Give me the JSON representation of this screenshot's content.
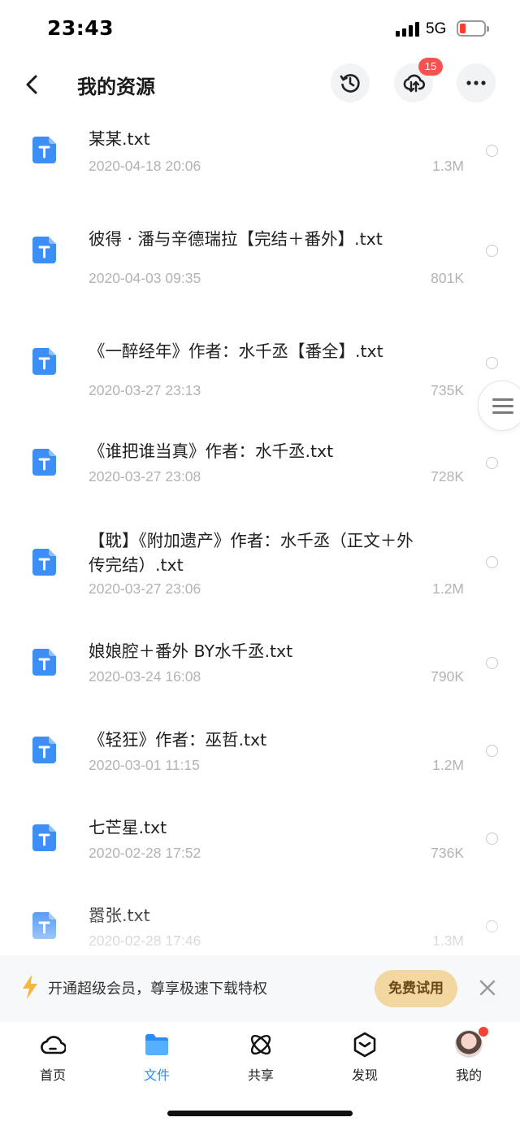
{
  "status_bar": {
    "time": "23:43",
    "network": "5G"
  },
  "header": {
    "title": "我的资源",
    "badge_count": "15"
  },
  "files": [
    {
      "name": "某某.txt",
      "date": "2020-04-18 20:06",
      "size": "1.3M"
    },
    {
      "name": "彼得 · 潘与辛德瑞拉【完结＋番外】.txt",
      "date": "2020-04-03 09:35",
      "size": "801K"
    },
    {
      "name": "《一醉经年》作者：水千丞【番全】.txt",
      "date": "2020-03-27 23:13",
      "size": "735K"
    },
    {
      "name": "《谁把谁当真》作者：水千丞.txt",
      "date": "2020-03-27 23:08",
      "size": "728K"
    },
    {
      "name": "【耽】《附加遗产》作者：水千丞（正文＋外传完结）.txt",
      "date": "2020-03-27 23:06",
      "size": "1.2M"
    },
    {
      "name": "娘娘腔＋番外 BY水千丞.txt",
      "date": "2020-03-24 16:08",
      "size": "790K"
    },
    {
      "name": "《轻狂》作者：巫哲.txt",
      "date": "2020-03-01 11:15",
      "size": "1.2M"
    },
    {
      "name": "七芒星.txt",
      "date": "2020-02-28 17:52",
      "size": "736K"
    },
    {
      "name": "嚣张.txt",
      "date": "2020-02-28 17:46",
      "size": "1.3M"
    }
  ],
  "promo": {
    "text": "开通超级会员，尊享极速下载特权",
    "button": "免费试用"
  },
  "tabs": [
    {
      "label": "首页",
      "icon": "cloud-icon"
    },
    {
      "label": "文件",
      "icon": "folder-icon"
    },
    {
      "label": "共享",
      "icon": "atom-icon"
    },
    {
      "label": "发现",
      "icon": "discover-icon"
    },
    {
      "label": "我的",
      "icon": "avatar"
    }
  ],
  "colors": {
    "accent": "#2a8cf5",
    "file_icon": "#3d8ef5",
    "badge": "#f8514f",
    "promo_button": "#f2d7a0"
  }
}
